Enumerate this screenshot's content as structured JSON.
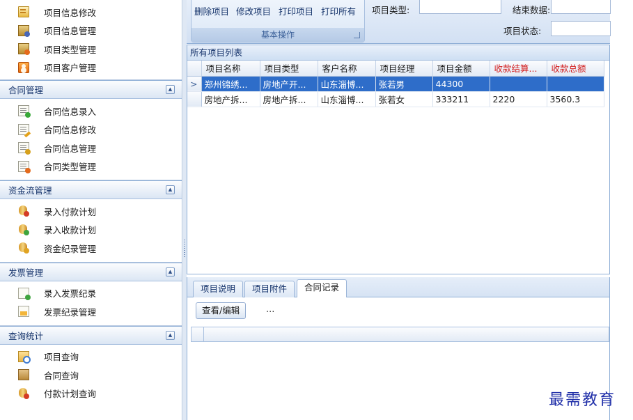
{
  "sidebar": {
    "project_items": [
      {
        "label": "项目信息修改",
        "icon": "document-edit-icon"
      },
      {
        "label": "项目信息管理",
        "icon": "folder-manage-icon"
      },
      {
        "label": "项目类型管理",
        "icon": "folder-type-icon"
      },
      {
        "label": "项目客户管理",
        "icon": "customer-icon"
      }
    ],
    "groups": [
      {
        "title": "合同管理",
        "items": [
          {
            "label": "合同信息录入",
            "icon": "sheet-add-icon"
          },
          {
            "label": "合同信息修改",
            "icon": "sheet-edit-icon"
          },
          {
            "label": "合同信息管理",
            "icon": "sheet-manage-icon"
          },
          {
            "label": "合同类型管理",
            "icon": "sheet-type-icon"
          }
        ]
      },
      {
        "title": "资金流管理",
        "items": [
          {
            "label": "录入付款计划",
            "icon": "coins-remove-icon"
          },
          {
            "label": "录入收款计划",
            "icon": "coins-add-icon"
          },
          {
            "label": "资金纪录管理",
            "icon": "coins-manage-icon"
          }
        ]
      },
      {
        "title": "发票管理",
        "items": [
          {
            "label": "录入发票纪录",
            "icon": "invoice-add-icon"
          },
          {
            "label": "发票纪录管理",
            "icon": "invoice-manage-icon"
          }
        ]
      },
      {
        "title": "查询统计",
        "items": [
          {
            "label": "项目查询",
            "icon": "folder-search-icon"
          },
          {
            "label": "合同查询",
            "icon": "book-icon"
          },
          {
            "label": "付款计划查询",
            "icon": "coins-remove-icon"
          }
        ]
      }
    ]
  },
  "ribbon": {
    "ops": [
      "删除项目",
      "修改项目",
      "打印项目",
      "打印所有"
    ],
    "group_caption": "基本操作",
    "fields": {
      "project_type_label": "项目类型:",
      "end_data_label": "结束数据:",
      "project_status_label": "项目状态:",
      "project_type_value": "",
      "end_data_value": "",
      "project_status_value": ""
    }
  },
  "list": {
    "title": "所有项目列表",
    "columns": [
      "项目名称",
      "项目类型",
      "客户名称",
      "项目经理",
      "项目金额",
      "收款结算...",
      "收款总额"
    ],
    "red_columns": [
      5,
      6
    ],
    "rows": [
      {
        "cells": [
          "郑州锦绣...",
          "房地产开...",
          "山东淄博...",
          "张若男",
          "44300",
          "",
          ""
        ],
        "selected": true,
        "indicator": ">"
      },
      {
        "cells": [
          "房地产拆...",
          "房地产拆...",
          "山东淄博...",
          "张若女",
          "333211",
          "2220",
          "3560.3"
        ],
        "selected": false,
        "indicator": ""
      }
    ]
  },
  "detail": {
    "tabs": [
      "项目说明",
      "项目附件",
      "合同记录"
    ],
    "active_tab": 2,
    "view_edit_label": "查看/编辑",
    "more_label": "..."
  },
  "watermark": "最需教育",
  "colors": {
    "selection": "#2e6dc9",
    "header_red": "#d21c1c",
    "border_blue": "#8eaed6",
    "watermark": "#1f2ea8"
  }
}
